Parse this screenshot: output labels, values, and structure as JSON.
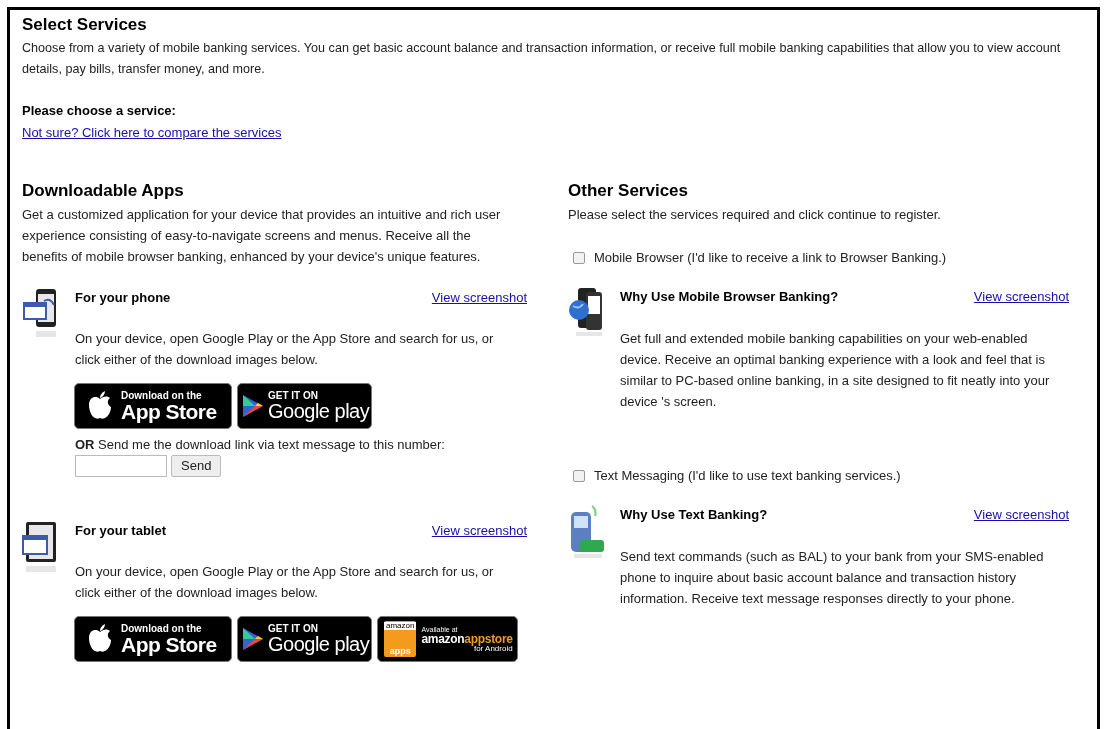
{
  "title": "Select Services",
  "intro": "Choose from a variety of mobile banking services. You can get basic account balance and transaction information, or receive full mobile banking capabilities that allow you to view account details, pay bills, transfer money, and more.",
  "prompt": "Please choose a service:",
  "compare_link": "Not sure? Click here to compare the services",
  "downloadable_apps": {
    "heading": "Downloadable Apps",
    "description": "Get a customized application for your device that provides an intuitive and rich user experience consisting of easy-to-navigate screens and menus. Receive all the benefits of mobile browser banking, enhanced by your device's unique features.",
    "devices": [
      {
        "kind": "phone",
        "title": "For your phone",
        "link": "View screenshot",
        "text": "On your device, open Google Play or the App Store and search for us, or click either of the download images below.",
        "badges": [
          {
            "kind": "apple",
            "top": "Download on the",
            "main": "App Store"
          },
          {
            "kind": "google",
            "top": "GET IT ON",
            "main": "Google play"
          }
        ],
        "sms": {
          "text": "**OR** Send me the download link via text message to this number:",
          "button": "Send"
        }
      },
      {
        "kind": "tablet",
        "title": "For your tablet",
        "link": "View screenshot",
        "text": "On your device, open Google Play or the App Store and search for us, or click either of the download images below.",
        "badges": [
          {
            "kind": "apple",
            "top": "Download on the",
            "main": "App Store"
          },
          {
            "kind": "google",
            "top": "GET IT ON",
            "main": "Google play"
          },
          {
            "kind": "amazon",
            "logo": "amazon",
            "sub": "apps",
            "top": "Available at",
            "main": "amazon",
            "main_accent": "appstore",
            "bottom": "for Android"
          }
        ]
      }
    ]
  },
  "other_services": {
    "heading": "Other Services",
    "description": "Please select the services required and click continue to register.",
    "services": [
      {
        "kind": "browser",
        "label": "Mobile Browser (I'd like to receive a link to Browser Banking.)",
        "checked": false,
        "title": "Why Use Mobile Browser Banking?",
        "link": "View screenshot",
        "text": "Get full and extended mobile banking capabilities on your web-enabled device. Receive an optimal banking experience with a look and feel that is similar to PC-based online banking, in a site designed to fit neatly into your device 's screen."
      },
      {
        "kind": "sms",
        "label": "Text Messaging (I'd like to use text banking services.)",
        "checked": false,
        "title": "Why Use Text Banking?",
        "link": "View screenshot",
        "text": "Send text commands (such as BAL) to your bank from your SMS-enabled phone to inquire about basic account balance and transaction history information. Receive text message responses directly to your phone."
      }
    ]
  }
}
